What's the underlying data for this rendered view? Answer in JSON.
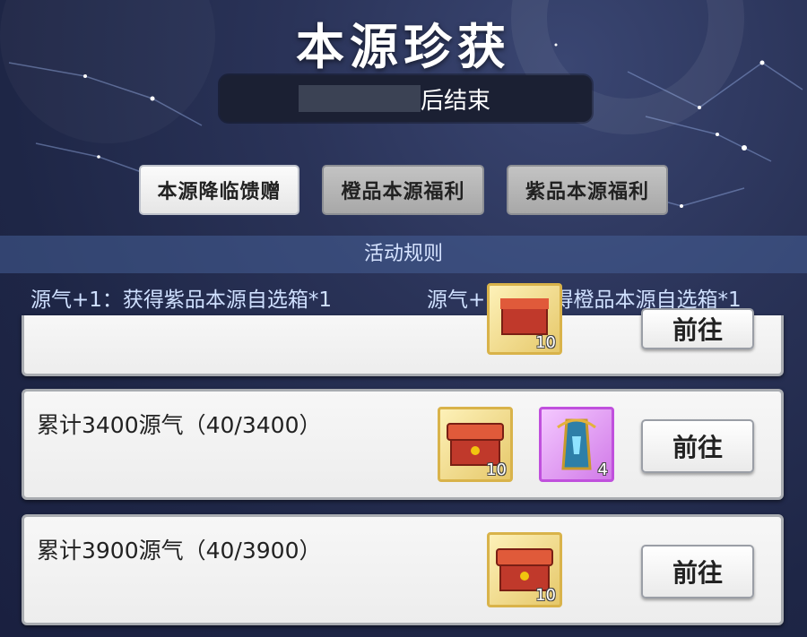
{
  "header": {
    "title": "本源珍获",
    "timer_suffix": "后结束"
  },
  "tabs": [
    {
      "label": "本源降临馈赠",
      "active": true
    },
    {
      "label": "橙品本源福利",
      "active": false
    },
    {
      "label": "紫品本源福利",
      "active": false
    }
  ],
  "rules": {
    "title": "活动规则",
    "lines": [
      "源气+1：获得紫品本源自选箱*1",
      "源气+10：获得橙品本源自选箱*1"
    ]
  },
  "tasks": [
    {
      "label": "",
      "items": [
        {
          "icon": "treasure-chest-icon",
          "count": "10"
        }
      ],
      "button": "前往"
    },
    {
      "label": "累计3400源气（40/3400）",
      "items": [
        {
          "icon": "treasure-chest-icon",
          "count": "10"
        },
        {
          "icon": "scroll-banner-icon",
          "count": "4"
        }
      ],
      "button": "前往"
    },
    {
      "label": "累计3900源气（40/3900）",
      "items": [
        {
          "icon": "treasure-chest-icon",
          "count": "10"
        }
      ],
      "button": "前往"
    }
  ]
}
